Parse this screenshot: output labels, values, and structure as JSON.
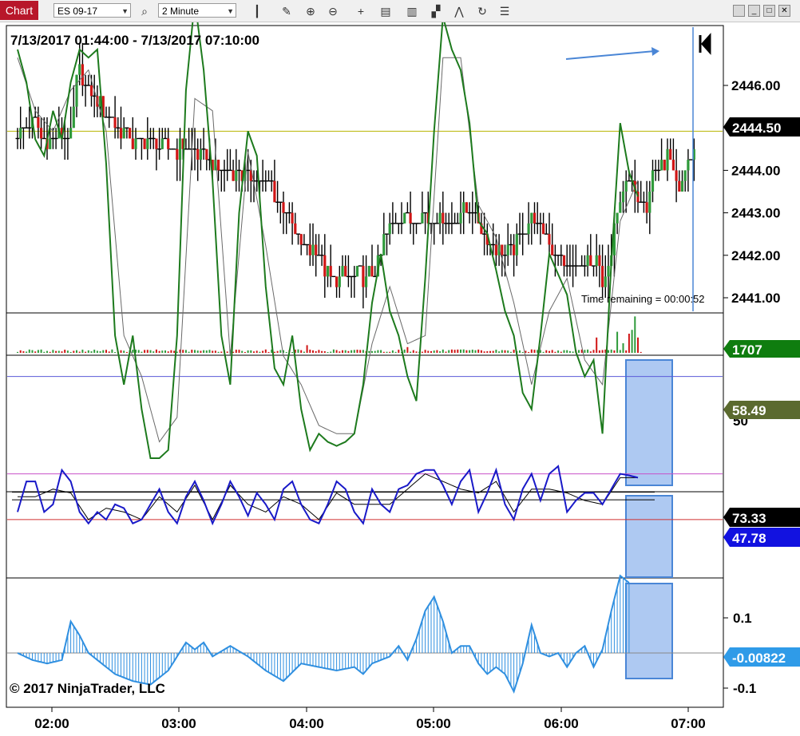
{
  "toolbar": {
    "tab_label": "Chart",
    "instrument": "ES 09-17",
    "interval": "2 Minute",
    "icons": [
      "search-icon",
      "bar-type-icon",
      "draw-icon",
      "zoom-in-icon",
      "zoom-out-icon",
      "crosshair-icon",
      "data-box-icon",
      "strategies-icon",
      "indicators-icon",
      "drawing-tools-icon",
      "reload-icon",
      "properties-icon"
    ]
  },
  "window_buttons": [
    "restore-icon",
    "minimize-icon",
    "maximize-icon",
    "close-icon"
  ],
  "colors": {
    "up": "#2e9a3a",
    "down": "#d01515",
    "wick": "#000000",
    "stoch_main": "#1d7a1d",
    "stoch_sig": "#6a6a6a",
    "osc_main": "#1919c8",
    "osc_sig": "#000000",
    "macd": "#2f8fe0",
    "highlight": "#aec9f2",
    "vline": "#4a86d6",
    "level_top": "#b8b400",
    "level_bottom": "#5a5ad8",
    "osc_top": "#c850c8",
    "osc_bottom": "#d03030"
  },
  "chart_data": {
    "type": "candlestick",
    "title": "7/13/2017 01:44:00 - 7/13/2017 07:10:00",
    "x_ticks": [
      "02:00",
      "03:00",
      "04:00",
      "05:00",
      "06:00",
      "07:00"
    ],
    "price_ticks": [
      "2446.00",
      "2445.00",
      "2444.00",
      "2443.00",
      "2442.00",
      "2441.00"
    ],
    "ylim": [
      2440.5,
      2446.5
    ],
    "price_path": [
      [
        0,
        2444.75
      ],
      [
        6,
        2445.2
      ],
      [
        9,
        2444.7
      ],
      [
        13,
        2444.8
      ],
      [
        18,
        2444.9
      ],
      [
        20,
        2446.1
      ],
      [
        21,
        2446.3
      ],
      [
        25,
        2445.8
      ],
      [
        30,
        2445.4
      ],
      [
        34,
        2445.0
      ],
      [
        40,
        2444.6
      ],
      [
        46,
        2444.7
      ],
      [
        51,
        2444.5
      ],
      [
        56,
        2444.5
      ],
      [
        61,
        2444.4
      ],
      [
        68,
        2444.1
      ],
      [
        75,
        2444.0
      ],
      [
        80,
        2443.8
      ],
      [
        85,
        2443.75
      ],
      [
        88,
        2443.3
      ],
      [
        91,
        2443.0
      ],
      [
        94,
        2442.5
      ],
      [
        97,
        2442.2
      ],
      [
        102,
        2442.05
      ],
      [
        105,
        2441.5
      ],
      [
        108,
        2441.4
      ],
      [
        110,
        2441.5
      ],
      [
        116,
        2441.5
      ],
      [
        120,
        2441.5
      ],
      [
        122,
        2441.8
      ],
      [
        124,
        2442.3
      ],
      [
        127,
        2442.7
      ],
      [
        130,
        2443.0
      ],
      [
        134,
        2442.8
      ],
      [
        138,
        2442.9
      ],
      [
        142,
        2442.8
      ],
      [
        146,
        2442.8
      ],
      [
        150,
        2443.0
      ],
      [
        154,
        2443.0
      ],
      [
        156,
        2442.8
      ],
      [
        159,
        2442.4
      ],
      [
        162,
        2442.1
      ],
      [
        164,
        2442.0
      ],
      [
        168,
        2442.2
      ],
      [
        171,
        2442.6
      ],
      [
        174,
        2442.9
      ],
      [
        178,
        2442.6
      ],
      [
        182,
        2442.0
      ],
      [
        186,
        2441.7
      ],
      [
        190,
        2441.8
      ],
      [
        194,
        2441.7
      ],
      [
        196,
        2441.8
      ],
      [
        198,
        2441.3
      ],
      [
        200,
        2441.6
      ],
      [
        201,
        2442.1
      ],
      [
        202,
        2442.7
      ],
      [
        204,
        2443.3
      ],
      [
        207,
        2443.8
      ],
      [
        210,
        2443.5
      ],
      [
        213,
        2443.2
      ],
      [
        215,
        2443.9
      ],
      [
        217,
        2444.1
      ],
      [
        220,
        2444.3
      ],
      [
        224,
        2443.5
      ],
      [
        226,
        2444.1
      ],
      [
        229,
        2444.5
      ]
    ],
    "volume": {
      "last_value": "1707",
      "spikes": [
        [
          98,
          0.2
        ],
        [
          132,
          0.15
        ],
        [
          196,
          0.4
        ],
        [
          203,
          0.55
        ],
        [
          205,
          0.25
        ],
        [
          207,
          0.5
        ],
        [
          208,
          0.6
        ],
        [
          209,
          0.95
        ],
        [
          210,
          0.4
        ]
      ]
    },
    "stochastics": {
      "value": "58.49",
      "levels": [
        80,
        20
      ],
      "visible_tick": "50",
      "main": [
        [
          0,
          100
        ],
        [
          3,
          92
        ],
        [
          6,
          78
        ],
        [
          9,
          74
        ],
        [
          12,
          85
        ],
        [
          15,
          78
        ],
        [
          18,
          92
        ],
        [
          21,
          100
        ],
        [
          24,
          98
        ],
        [
          27,
          100
        ],
        [
          30,
          72
        ],
        [
          33,
          30
        ],
        [
          36,
          18
        ],
        [
          39,
          30
        ],
        [
          42,
          12
        ],
        [
          45,
          0
        ],
        [
          48,
          0
        ],
        [
          51,
          2
        ],
        [
          54,
          30
        ],
        [
          57,
          90
        ],
        [
          60,
          112
        ],
        [
          63,
          95
        ],
        [
          66,
          68
        ],
        [
          69,
          30
        ],
        [
          72,
          18
        ],
        [
          75,
          60
        ],
        [
          78,
          80
        ],
        [
          81,
          74
        ],
        [
          84,
          42
        ],
        [
          87,
          22
        ],
        [
          90,
          18
        ],
        [
          93,
          30
        ],
        [
          96,
          12
        ],
        [
          99,
          2
        ],
        [
          102,
          6
        ],
        [
          105,
          4
        ],
        [
          108,
          3
        ],
        [
          111,
          4
        ],
        [
          114,
          6
        ],
        [
          117,
          18
        ],
        [
          120,
          38
        ],
        [
          123,
          50
        ],
        [
          126,
          36
        ],
        [
          129,
          30
        ],
        [
          132,
          20
        ],
        [
          135,
          14
        ],
        [
          138,
          44
        ],
        [
          141,
          80
        ],
        [
          144,
          108
        ],
        [
          147,
          100
        ],
        [
          150,
          95
        ],
        [
          153,
          82
        ],
        [
          156,
          58
        ],
        [
          159,
          55
        ],
        [
          162,
          46
        ],
        [
          165,
          36
        ],
        [
          168,
          30
        ],
        [
          171,
          16
        ],
        [
          174,
          12
        ],
        [
          177,
          30
        ],
        [
          180,
          50
        ],
        [
          183,
          45
        ],
        [
          186,
          40
        ],
        [
          189,
          26
        ],
        [
          192,
          20
        ],
        [
          195,
          24
        ],
        [
          198,
          6
        ],
        [
          201,
          48
        ],
        [
          204,
          82
        ],
        [
          207,
          70
        ],
        [
          210,
          64
        ]
      ],
      "signal": [
        [
          0,
          98
        ],
        [
          6,
          85
        ],
        [
          12,
          80
        ],
        [
          18,
          90
        ],
        [
          24,
          95
        ],
        [
          30,
          80
        ],
        [
          36,
          30
        ],
        [
          42,
          20
        ],
        [
          48,
          4
        ],
        [
          54,
          10
        ],
        [
          60,
          88
        ],
        [
          66,
          85
        ],
        [
          72,
          25
        ],
        [
          78,
          75
        ],
        [
          84,
          52
        ],
        [
          90,
          25
        ],
        [
          96,
          18
        ],
        [
          102,
          8
        ],
        [
          108,
          6
        ],
        [
          114,
          6
        ],
        [
          120,
          28
        ],
        [
          126,
          42
        ],
        [
          132,
          28
        ],
        [
          138,
          30
        ],
        [
          144,
          98
        ],
        [
          150,
          98
        ],
        [
          156,
          62
        ],
        [
          162,
          54
        ],
        [
          168,
          38
        ],
        [
          174,
          18
        ],
        [
          180,
          36
        ],
        [
          186,
          44
        ],
        [
          192,
          24
        ],
        [
          198,
          18
        ],
        [
          204,
          58
        ],
        [
          210,
          68
        ]
      ]
    },
    "oscillator": {
      "value_top": "73.33",
      "value_mid": "47.78",
      "levels": [
        80,
        20
      ],
      "main": [
        [
          0,
          30
        ],
        [
          3,
          70
        ],
        [
          6,
          70
        ],
        [
          9,
          30
        ],
        [
          12,
          40
        ],
        [
          15,
          85
        ],
        [
          18,
          70
        ],
        [
          21,
          30
        ],
        [
          24,
          15
        ],
        [
          27,
          30
        ],
        [
          30,
          20
        ],
        [
          33,
          40
        ],
        [
          36,
          35
        ],
        [
          39,
          15
        ],
        [
          42,
          20
        ],
        [
          45,
          40
        ],
        [
          48,
          60
        ],
        [
          51,
          30
        ],
        [
          54,
          15
        ],
        [
          57,
          50
        ],
        [
          60,
          70
        ],
        [
          63,
          45
        ],
        [
          66,
          15
        ],
        [
          69,
          40
        ],
        [
          72,
          70
        ],
        [
          75,
          50
        ],
        [
          78,
          25
        ],
        [
          81,
          55
        ],
        [
          84,
          40
        ],
        [
          87,
          20
        ],
        [
          90,
          60
        ],
        [
          93,
          70
        ],
        [
          96,
          40
        ],
        [
          99,
          20
        ],
        [
          102,
          15
        ],
        [
          105,
          40
        ],
        [
          108,
          70
        ],
        [
          111,
          60
        ],
        [
          114,
          30
        ],
        [
          117,
          15
        ],
        [
          120,
          60
        ],
        [
          123,
          40
        ],
        [
          126,
          30
        ],
        [
          129,
          60
        ],
        [
          132,
          65
        ],
        [
          135,
          80
        ],
        [
          138,
          85
        ],
        [
          141,
          85
        ],
        [
          144,
          65
        ],
        [
          147,
          40
        ],
        [
          150,
          70
        ],
        [
          153,
          85
        ],
        [
          156,
          30
        ],
        [
          159,
          55
        ],
        [
          162,
          85
        ],
        [
          165,
          40
        ],
        [
          168,
          20
        ],
        [
          171,
          60
        ],
        [
          174,
          80
        ],
        [
          177,
          45
        ],
        [
          180,
          80
        ],
        [
          183,
          90
        ],
        [
          186,
          30
        ],
        [
          189,
          45
        ],
        [
          192,
          55
        ],
        [
          195,
          55
        ],
        [
          198,
          40
        ],
        [
          201,
          60
        ],
        [
          204,
          80
        ],
        [
          207,
          78
        ],
        [
          210,
          75
        ]
      ],
      "signal": [
        [
          0,
          50
        ],
        [
          6,
          50
        ],
        [
          12,
          60
        ],
        [
          18,
          55
        ],
        [
          24,
          20
        ],
        [
          30,
          35
        ],
        [
          36,
          30
        ],
        [
          42,
          20
        ],
        [
          48,
          50
        ],
        [
          54,
          30
        ],
        [
          60,
          65
        ],
        [
          66,
          20
        ],
        [
          72,
          65
        ],
        [
          78,
          40
        ],
        [
          84,
          30
        ],
        [
          90,
          50
        ],
        [
          96,
          40
        ],
        [
          102,
          20
        ],
        [
          108,
          55
        ],
        [
          114,
          40
        ],
        [
          120,
          40
        ],
        [
          126,
          40
        ],
        [
          132,
          60
        ],
        [
          138,
          80
        ],
        [
          144,
          70
        ],
        [
          150,
          60
        ],
        [
          156,
          55
        ],
        [
          162,
          70
        ],
        [
          168,
          30
        ],
        [
          174,
          60
        ],
        [
          180,
          60
        ],
        [
          186,
          55
        ],
        [
          192,
          45
        ],
        [
          198,
          40
        ],
        [
          204,
          75
        ],
        [
          210,
          75
        ]
      ]
    },
    "macd": {
      "value": "-0.00822",
      "ticks": [
        "0.1",
        "-0.1"
      ],
      "series": [
        [
          0,
          0.0
        ],
        [
          5,
          -0.02
        ],
        [
          10,
          -0.03
        ],
        [
          15,
          -0.02
        ],
        [
          18,
          0.09
        ],
        [
          21,
          0.05
        ],
        [
          24,
          0.0
        ],
        [
          27,
          -0.02
        ],
        [
          33,
          -0.06
        ],
        [
          39,
          -0.08
        ],
        [
          45,
          -0.09
        ],
        [
          51,
          -0.05
        ],
        [
          57,
          0.03
        ],
        [
          60,
          0.01
        ],
        [
          63,
          0.03
        ],
        [
          66,
          -0.01
        ],
        [
          72,
          0.02
        ],
        [
          78,
          -0.01
        ],
        [
          84,
          -0.05
        ],
        [
          90,
          -0.08
        ],
        [
          96,
          -0.03
        ],
        [
          102,
          -0.04
        ],
        [
          108,
          -0.05
        ],
        [
          114,
          -0.04
        ],
        [
          117,
          -0.06
        ],
        [
          120,
          -0.03
        ],
        [
          123,
          -0.02
        ],
        [
          126,
          -0.01
        ],
        [
          129,
          0.02
        ],
        [
          132,
          -0.02
        ],
        [
          135,
          0.04
        ],
        [
          138,
          0.12
        ],
        [
          141,
          0.16
        ],
        [
          144,
          0.09
        ],
        [
          147,
          0.0
        ],
        [
          150,
          0.02
        ],
        [
          153,
          0.02
        ],
        [
          156,
          -0.03
        ],
        [
          159,
          -0.06
        ],
        [
          162,
          -0.04
        ],
        [
          165,
          -0.06
        ],
        [
          168,
          -0.11
        ],
        [
          171,
          -0.03
        ],
        [
          174,
          0.08
        ],
        [
          177,
          0.0
        ],
        [
          180,
          -0.01
        ],
        [
          183,
          0.0
        ],
        [
          186,
          -0.04
        ],
        [
          189,
          0.0
        ],
        [
          192,
          0.02
        ],
        [
          195,
          -0.04
        ],
        [
          198,
          0.01
        ],
        [
          201,
          0.12
        ],
        [
          204,
          0.22
        ],
        [
          207,
          0.2
        ]
      ]
    }
  },
  "overlay_text": {
    "time_remaining": "Time remaining = 00:00:52",
    "price_badge": "2444.50",
    "copyright": "© 2017 NinjaTrader, LLC"
  }
}
